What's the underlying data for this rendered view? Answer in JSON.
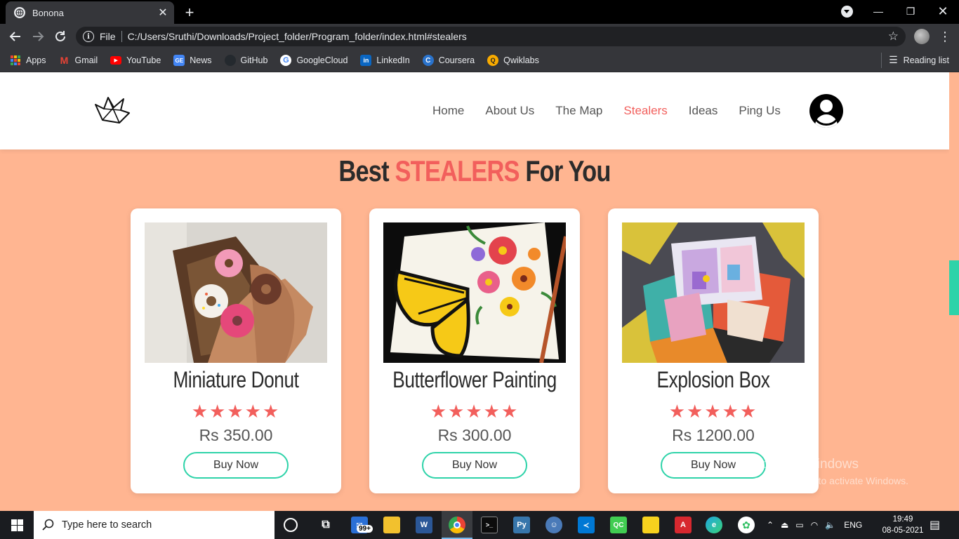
{
  "browser": {
    "tab_title": "Bonona",
    "omnibox_scheme": "File",
    "url": "C:/Users/Sruthi/Downloads/Project_folder/Program_folder/index.html#stealers",
    "bookmarks": [
      {
        "label": "Apps",
        "icon": "apps-grid-icon"
      },
      {
        "label": "Gmail",
        "icon": "gmail-icon",
        "color": "#ea4335"
      },
      {
        "label": "YouTube",
        "icon": "youtube-icon",
        "color": "#ff0000"
      },
      {
        "label": "News",
        "icon": "google-news-icon",
        "color": "#4285f4"
      },
      {
        "label": "GitHub",
        "icon": "github-icon",
        "color": "#24292e"
      },
      {
        "label": "GoogleCloud",
        "icon": "google-icon",
        "color": "#ffffff"
      },
      {
        "label": "LinkedIn",
        "icon": "linkedin-icon",
        "color": "#0a66c2"
      },
      {
        "label": "Coursera",
        "icon": "coursera-icon",
        "color": "#2a73cc"
      },
      {
        "label": "Qwiklabs",
        "icon": "qwiklabs-icon",
        "color": "#f9ab00"
      }
    ],
    "reading_list": "Reading list"
  },
  "site": {
    "nav": [
      {
        "label": "Home",
        "active": false
      },
      {
        "label": "About Us",
        "active": false
      },
      {
        "label": "The Map",
        "active": false
      },
      {
        "label": "Stealers",
        "active": true
      },
      {
        "label": "Ideas",
        "active": false
      },
      {
        "label": "Ping Us",
        "active": false
      }
    ],
    "section_title_pre": "Best ",
    "section_title_hl": "STEALERS",
    "section_title_post": " For You",
    "accent": "#f25f5c",
    "button_border": "#2ed3a9",
    "page_bg": "#ffb591",
    "products": [
      {
        "name": "Miniature Donut",
        "rating": 5,
        "stars": "★★★★★",
        "price": "Rs 350.00",
        "button": "Buy Now"
      },
      {
        "name": "Butterflower Painting",
        "rating": 5,
        "stars": "★★★★★",
        "price": "Rs 300.00",
        "button": "Buy Now"
      },
      {
        "name": "Explosion Box",
        "rating": 5,
        "stars": "★★★★★",
        "price": "Rs 1200.00",
        "button": "Buy Now"
      }
    ]
  },
  "watermark": {
    "line1": "Activate Windows",
    "line2": "Go to Settings to activate Windows."
  },
  "taskbar": {
    "search_placeholder": "Type here to search",
    "mail_badge": "99+",
    "lang": "ENG",
    "time": "19:49",
    "date": "08-05-2021"
  }
}
